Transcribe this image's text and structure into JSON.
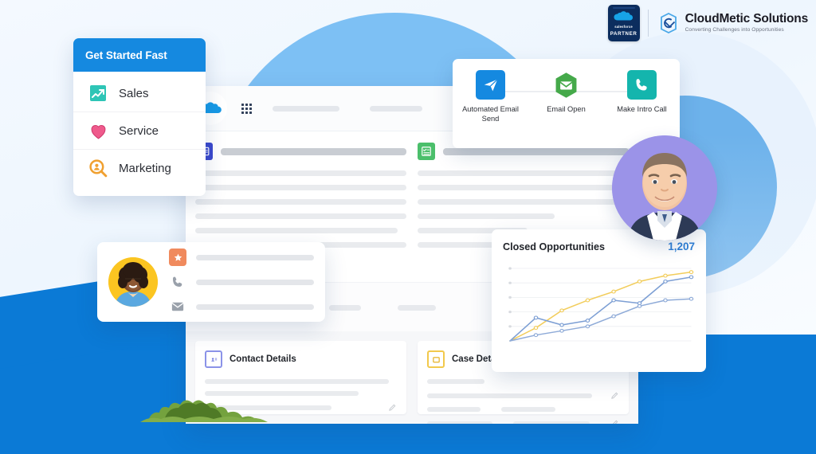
{
  "header": {
    "partner_badge": {
      "brand": "salesforce",
      "label": "PARTNER"
    },
    "company": {
      "name": "CloudMetic Solutions",
      "tagline": "Converting Challenges into Opportunities"
    }
  },
  "get_started_card": {
    "title": "Get Started Fast",
    "items": [
      {
        "label": "Sales",
        "icon": "sales-chart-icon",
        "color": "#2ec5b6"
      },
      {
        "label": "Service",
        "icon": "heart-icon",
        "color": "#ef5a8c"
      },
      {
        "label": "Marketing",
        "icon": "marketing-search-icon",
        "color": "#f0a030"
      }
    ]
  },
  "workflow_card": {
    "steps": [
      {
        "label": "Automated Email Send",
        "icon": "send-icon",
        "color": "#1589e0"
      },
      {
        "label": "Email Open",
        "icon": "envelope-hexagon-icon",
        "color": "#45a94a"
      },
      {
        "label": "Make Intro Call",
        "icon": "phone-icon",
        "color": "#14b5ad"
      }
    ]
  },
  "chart_card": {
    "title": "Closed Opportunities",
    "value": "1,207"
  },
  "chart_data": {
    "type": "line",
    "title": "Closed Opportunities",
    "value_label": "1,207",
    "x": [
      0,
      1,
      2,
      3,
      4,
      5,
      6,
      7
    ],
    "series": [
      {
        "name": "yellow-series",
        "color": "#f2cd5c",
        "values": [
          0,
          18,
          42,
          56,
          68,
          82,
          90,
          95
        ]
      },
      {
        "name": "blue-series",
        "color": "#7d9fd4",
        "values": [
          0,
          32,
          22,
          28,
          56,
          52,
          82,
          88
        ]
      },
      {
        "name": "light-blue-series",
        "color": "#8fabd8",
        "values": [
          0,
          8,
          14,
          20,
          34,
          48,
          56,
          58
        ]
      }
    ],
    "ylim": [
      0,
      100
    ],
    "grid": true,
    "legend": "none",
    "xlabel": "",
    "ylabel": ""
  },
  "contact_card": {
    "avatar": "woman-avatar",
    "badge_icon": "star-badge-icon",
    "rows": [
      {
        "icon": "star-badge-icon"
      },
      {
        "icon": "phone-icon"
      },
      {
        "icon": "envelope-icon"
      }
    ]
  },
  "console": {
    "logo": "salesforce-cloud-logo",
    "app_launcher": "app-launcher-grid-icon",
    "panels": [
      {
        "icon": "contact-card-icon",
        "color": "#3b49cd"
      },
      {
        "icon": "checklist-icon",
        "color": "#4bbf6b"
      }
    ],
    "detail_cards": [
      {
        "title": "Contact Details",
        "icon": "id-card-icon",
        "color": "#8b93e8"
      },
      {
        "title": "Case Details",
        "icon": "folder-icon",
        "color": "#f2c94c"
      }
    ]
  },
  "person_photo": {
    "alt": "smiling-man-portrait"
  },
  "colors": {
    "brand_blue": "#1589e0",
    "deep_blue": "#0b7ad6",
    "accent_value": "#2f7fd6",
    "sky": "#7dc0f4",
    "bush_green": "#6a9b35"
  }
}
